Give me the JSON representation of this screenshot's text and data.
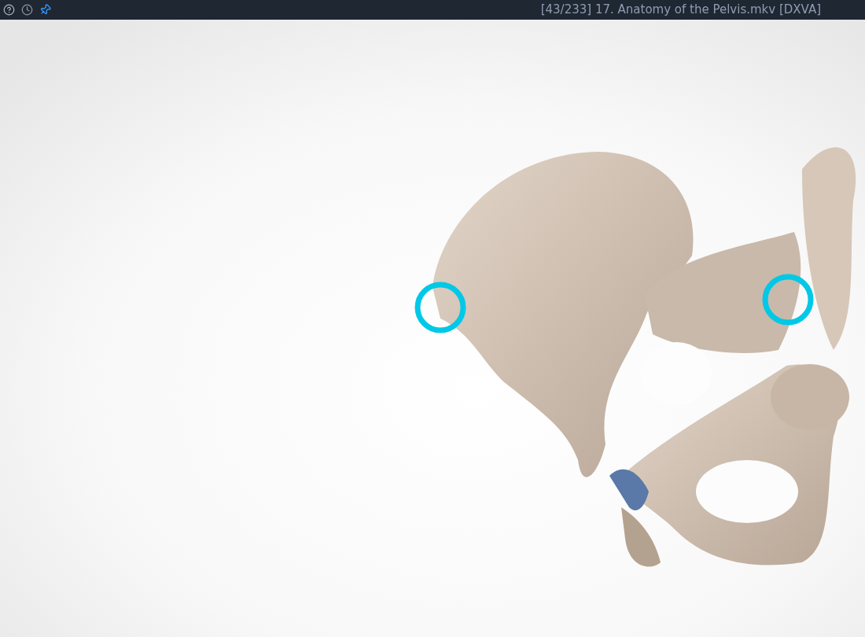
{
  "title_bar": {
    "pinned": true,
    "title": "[43/233] 17. Anatomy of the Pelvis.mkv [DXVA]"
  }
}
